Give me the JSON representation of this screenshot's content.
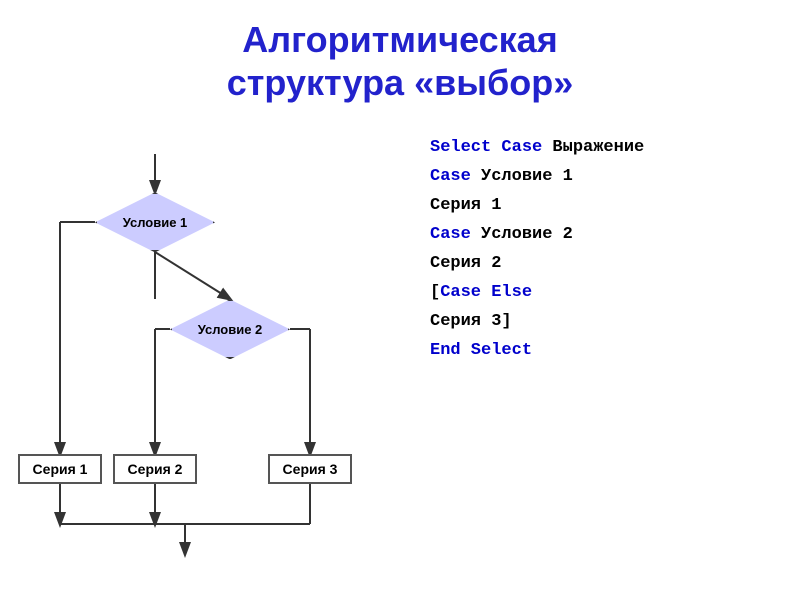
{
  "title": {
    "line1": "Алгоритмическая",
    "line2": "структура «выбор»"
  },
  "flowchart": {
    "diamond1_label": "Условие 1",
    "diamond2_label": "Условие 2",
    "rect1_label": "Серия 1",
    "rect2_label": "Серия 2",
    "rect3_label": "Серия 3"
  },
  "code": {
    "line1_blue": "Select Case",
    "line1_black": " Выражение",
    "line2_blue": "Case",
    "line2_black": " Условие 1",
    "line3": "    Серия 1",
    "line4_blue": "Case",
    "line4_black": " Условие 2",
    "line5": "    Серия 2",
    "line6_bracket": "[",
    "line6_blue": "Case Else",
    "line7": "    Серия 3]",
    "line8_blue": "End Select"
  }
}
